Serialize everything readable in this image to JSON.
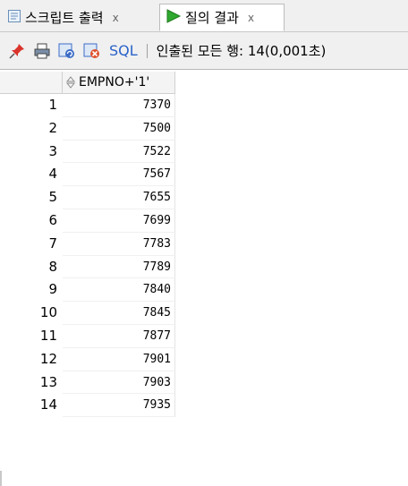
{
  "tabs": [
    {
      "label": "스크립트 출력",
      "close": "x",
      "icon": "script-output-icon"
    },
    {
      "label": "질의 결과",
      "close": "x",
      "icon": "run-arrow-icon"
    }
  ],
  "toolbar": {
    "icons": [
      "pin-icon",
      "print-icon",
      "refresh-icon",
      "delete-icon"
    ],
    "sql_label": "SQL",
    "separator": "|",
    "status": "인출된 모든 행: 14(0,001초)"
  },
  "grid": {
    "column_header": "EMPNO+'1'",
    "rows": [
      {
        "num": "1",
        "value": "7370"
      },
      {
        "num": "2",
        "value": "7500"
      },
      {
        "num": "3",
        "value": "7522"
      },
      {
        "num": "4",
        "value": "7567"
      },
      {
        "num": "5",
        "value": "7655"
      },
      {
        "num": "6",
        "value": "7699"
      },
      {
        "num": "7",
        "value": "7783"
      },
      {
        "num": "8",
        "value": "7789"
      },
      {
        "num": "9",
        "value": "7840"
      },
      {
        "num": "10",
        "value": "7845"
      },
      {
        "num": "11",
        "value": "7877"
      },
      {
        "num": "12",
        "value": "7901"
      },
      {
        "num": "13",
        "value": "7903"
      },
      {
        "num": "14",
        "value": "7935"
      }
    ]
  },
  "colors": {
    "run_arrow": "#2fa82f",
    "sql_link": "#2a63c9",
    "pin": "#d9342b"
  }
}
